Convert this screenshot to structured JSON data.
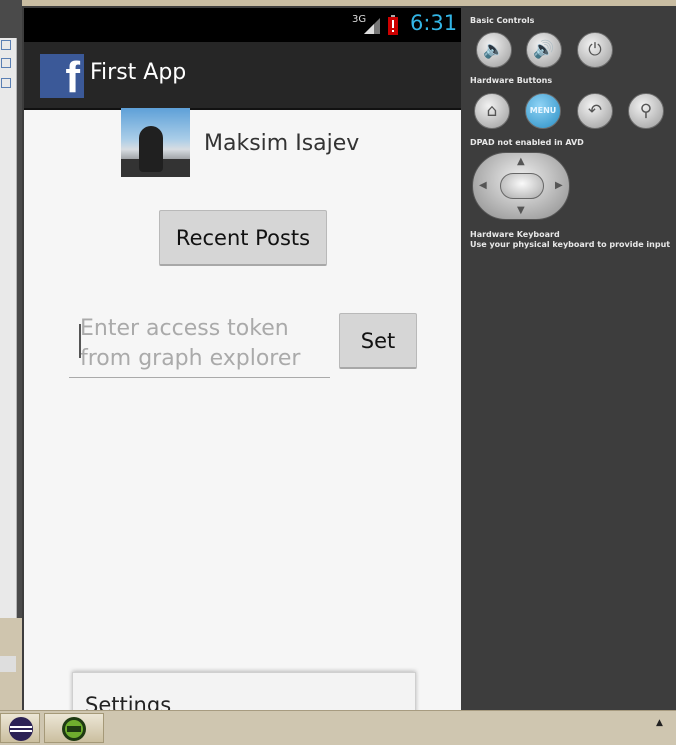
{
  "status_bar": {
    "network": "3G",
    "time": "6:31",
    "accent_color": "#33b5e5"
  },
  "action_bar": {
    "logo_letter": "f",
    "title": "First App"
  },
  "profile": {
    "name": "Maksim Isajev"
  },
  "buttons": {
    "recent_posts": "Recent Posts",
    "set": "Set"
  },
  "token_input": {
    "placeholder": "Enter access token from graph explorer",
    "value": ""
  },
  "options_menu": {
    "items": [
      "Settings"
    ]
  },
  "emulator_controls": {
    "basic_controls_label": "Basic Controls",
    "hardware_buttons_label": "Hardware Buttons",
    "menu_button": "MENU",
    "dpad_label": "DPAD not enabled in AVD",
    "keyboard_label": "Hardware Keyboard",
    "keyboard_sub": "Use your physical keyboard to provide input"
  },
  "taskbar": {
    "items": [
      "eclipse-icon",
      "android-emulator-icon"
    ]
  },
  "colors": {
    "facebook_blue": "#3b5998",
    "menu_button_blue": "#2a8fc5"
  }
}
